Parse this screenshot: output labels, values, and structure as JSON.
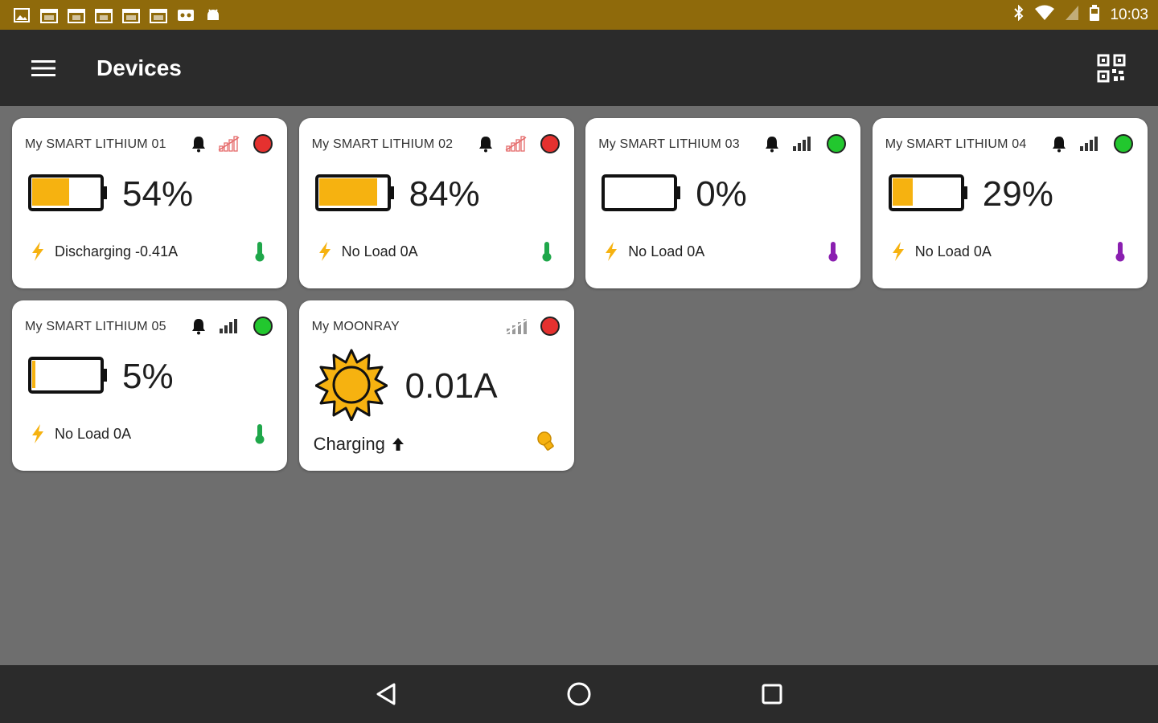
{
  "status_bar": {
    "time": "10:03",
    "notif_icons": [
      "image-icon",
      "calendar-icon",
      "calendar-icon",
      "calendar-icon",
      "calendar-icon",
      "calendar-icon",
      "voicemail-icon",
      "android-icon"
    ],
    "status_icons": [
      "bluetooth-icon",
      "wifi-icon",
      "no-sim-icon",
      "battery-icon"
    ]
  },
  "app_bar": {
    "title": "Devices"
  },
  "devices": [
    {
      "name": "My SMART LITHIUM 01",
      "percent": "54%",
      "level": 0.54,
      "status": "Discharging -0.41A",
      "signal": "weak",
      "connected": false,
      "thermometer_color": "#1fa74a"
    },
    {
      "name": "My SMART LITHIUM 02",
      "percent": "84%",
      "level": 0.84,
      "status": "No Load 0A",
      "signal": "weak",
      "connected": false,
      "thermometer_color": "#1fa74a"
    },
    {
      "name": "My SMART LITHIUM 03",
      "percent": "0%",
      "level": 0.0,
      "status": "No Load 0A",
      "signal": "strong",
      "connected": true,
      "thermometer_color": "#8a1fb0"
    },
    {
      "name": "My SMART LITHIUM 04",
      "percent": "29%",
      "level": 0.29,
      "status": "No Load 0A",
      "signal": "strong",
      "connected": true,
      "thermometer_color": "#8a1fb0"
    },
    {
      "name": "My SMART LITHIUM 05",
      "percent": "5%",
      "level": 0.05,
      "status": "No Load 0A",
      "signal": "strong",
      "connected": true,
      "thermometer_color": "#1fa74a"
    }
  ],
  "moonray": {
    "name": "My MOONRAY",
    "current": "0.01A",
    "status": "Charging",
    "signal": "off",
    "connected": false
  },
  "colors": {
    "accent": "#f6b210",
    "status_bar": "#8f6a0b",
    "app_bar": "#2b2b2b",
    "background": "#6e6e6e",
    "connected": "#22c72e",
    "disconnected": "#e5312f",
    "signal_weak": "#e56a6a",
    "signal_strong": "#333333"
  },
  "nav": {
    "icons": [
      "back-icon",
      "home-icon",
      "recents-icon"
    ]
  }
}
